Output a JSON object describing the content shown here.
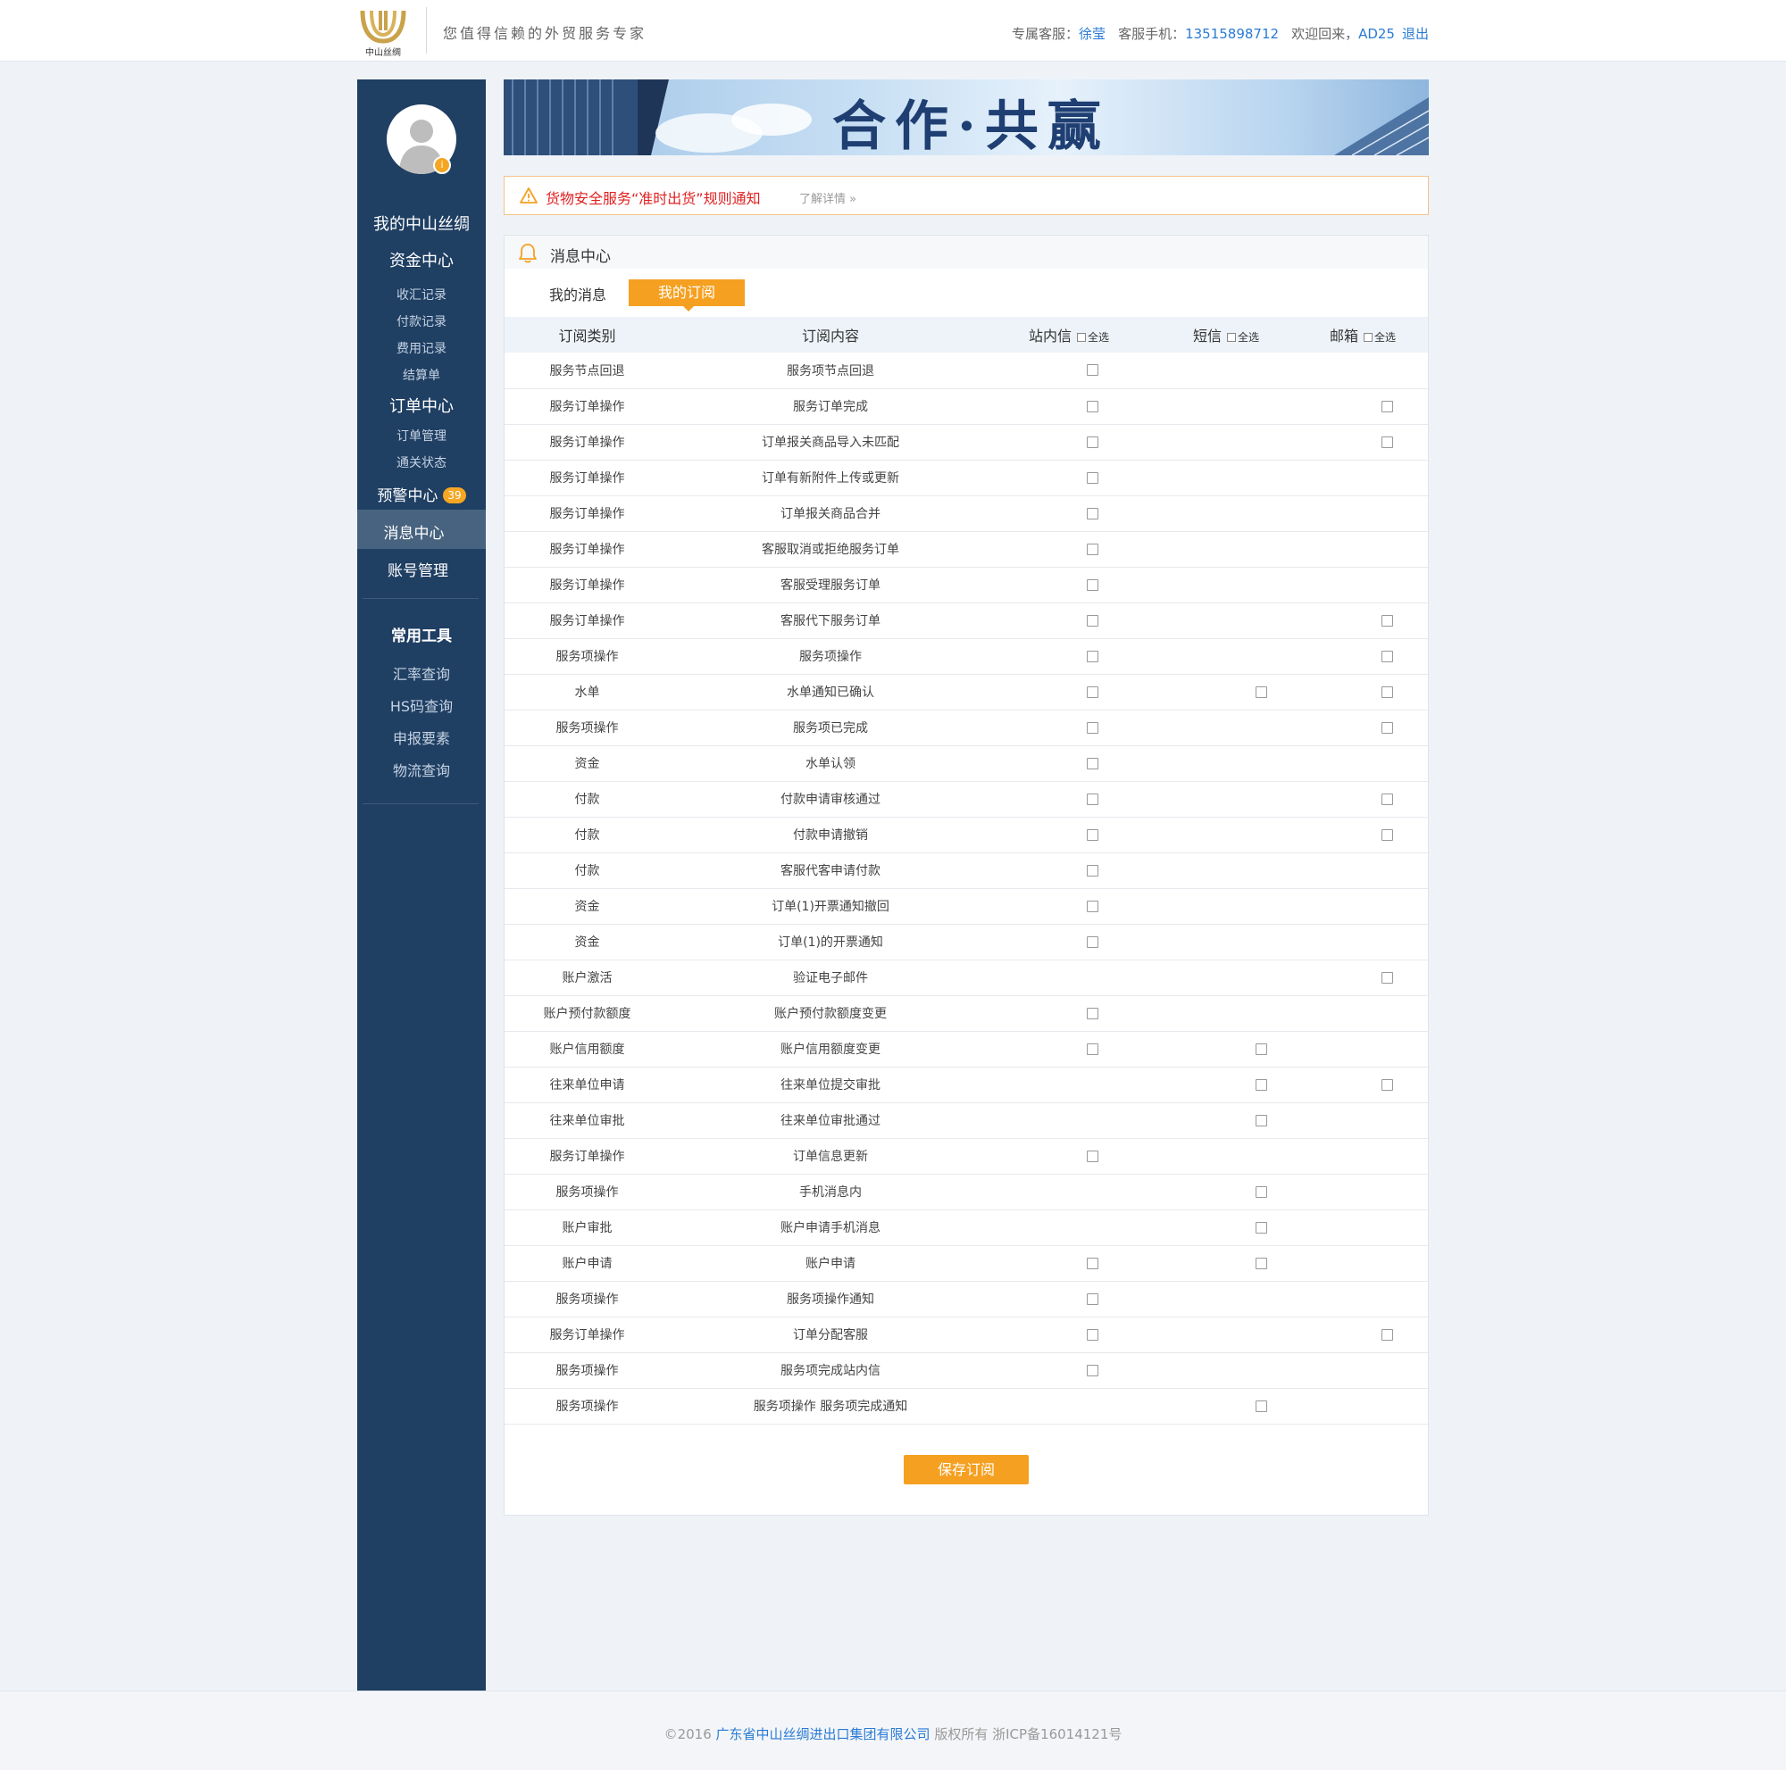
{
  "header": {
    "logo_text": "中山丝绸",
    "slogan": "您值得信赖的外贸服务专家",
    "service_label": "专属客服：",
    "service_name": "徐莹",
    "phone_label": "客服手机：",
    "phone": "13515898712",
    "welcome": "欢迎回来，",
    "username": "AD25",
    "logout": "退出"
  },
  "sidebar": {
    "avatar_badge": "i",
    "my_title": "我的中山丝绸",
    "fund_center": "资金中心",
    "fund_items": [
      "收汇记录",
      "付款记录",
      "费用记录",
      "结算单"
    ],
    "order_center": "订单中心",
    "order_items": [
      "订单管理",
      "通关状态"
    ],
    "warn_center": "预警中心",
    "warn_count": "39",
    "msg_center": "消息中心",
    "account": "账号管理",
    "tools_title": "常用工具",
    "tools": [
      "汇率查询",
      "HS码查询",
      "申报要素",
      "物流查询"
    ]
  },
  "banner": {
    "text": "合作·共赢"
  },
  "notice": {
    "text": "货物安全服务“准时出货”规则通知",
    "more": "了解详情 »"
  },
  "panel": {
    "title": "消息中心",
    "tabs": [
      "我的消息",
      "我的订阅"
    ],
    "columns": {
      "category": "订阅类别",
      "content": "订阅内容",
      "inbox": "站内信",
      "sms": "短信",
      "mail": "邮箱"
    },
    "select_all": "全选",
    "rows": [
      {
        "cat": "服务节点回退",
        "content": "服务项节点回退",
        "in": true,
        "sms": false,
        "mail": false
      },
      {
        "cat": "服务订单操作",
        "content": "服务订单完成",
        "in": true,
        "sms": false,
        "mail": true
      },
      {
        "cat": "服务订单操作",
        "content": "订单报关商品导入未匹配",
        "in": true,
        "sms": false,
        "mail": true
      },
      {
        "cat": "服务订单操作",
        "content": "订单有新附件上传或更新",
        "in": true,
        "sms": false,
        "mail": false
      },
      {
        "cat": "服务订单操作",
        "content": "订单报关商品合并",
        "in": true,
        "sms": false,
        "mail": false
      },
      {
        "cat": "服务订单操作",
        "content": "客服取消或拒绝服务订单",
        "in": true,
        "sms": false,
        "mail": false
      },
      {
        "cat": "服务订单操作",
        "content": "客服受理服务订单",
        "in": true,
        "sms": false,
        "mail": false
      },
      {
        "cat": "服务订单操作",
        "content": "客服代下服务订单",
        "in": true,
        "sms": false,
        "mail": true
      },
      {
        "cat": "服务项操作",
        "content": "服务项操作",
        "in": true,
        "sms": false,
        "mail": true
      },
      {
        "cat": "水单",
        "content": "水单通知已确认",
        "in": true,
        "sms": true,
        "mail": true
      },
      {
        "cat": "服务项操作",
        "content": "服务项已完成",
        "in": true,
        "sms": false,
        "mail": true
      },
      {
        "cat": "资金",
        "content": "水单认领",
        "in": true,
        "sms": false,
        "mail": false
      },
      {
        "cat": "付款",
        "content": "付款申请审核通过",
        "in": true,
        "sms": false,
        "mail": true
      },
      {
        "cat": "付款",
        "content": "付款申请撤销",
        "in": true,
        "sms": false,
        "mail": true
      },
      {
        "cat": "付款",
        "content": "客服代客申请付款",
        "in": true,
        "sms": false,
        "mail": false
      },
      {
        "cat": "资金",
        "content": "订单(1)开票通知撤回",
        "in": true,
        "sms": false,
        "mail": false
      },
      {
        "cat": "资金",
        "content": "订单(1)的开票通知",
        "in": true,
        "sms": false,
        "mail": false
      },
      {
        "cat": "账户激活",
        "content": "验证电子邮件",
        "in": false,
        "sms": false,
        "mail": true
      },
      {
        "cat": "账户预付款额度",
        "content": "账户预付款额度变更",
        "in": true,
        "sms": false,
        "mail": false
      },
      {
        "cat": "账户信用额度",
        "content": "账户信用额度变更",
        "in": true,
        "sms": true,
        "mail": false
      },
      {
        "cat": "往来单位申请",
        "content": "往来单位提交审批",
        "in": false,
        "sms": true,
        "mail": true
      },
      {
        "cat": "往来单位审批",
        "content": "往来单位审批通过",
        "in": false,
        "sms": true,
        "mail": false
      },
      {
        "cat": "服务订单操作",
        "content": "订单信息更新",
        "in": true,
        "sms": false,
        "mail": false
      },
      {
        "cat": "服务项操作",
        "content": "手机消息内",
        "in": false,
        "sms": true,
        "mail": false
      },
      {
        "cat": "账户审批",
        "content": "账户申请手机消息",
        "in": false,
        "sms": true,
        "mail": false
      },
      {
        "cat": "账户申请",
        "content": "账户申请",
        "in": true,
        "sms": true,
        "mail": false
      },
      {
        "cat": "服务项操作",
        "content": "服务项操作通知",
        "in": true,
        "sms": false,
        "mail": false
      },
      {
        "cat": "服务订单操作",
        "content": "订单分配客服",
        "in": true,
        "sms": false,
        "mail": true
      },
      {
        "cat": "服务项操作",
        "content": "服务项完成站内信",
        "in": true,
        "sms": false,
        "mail": false
      },
      {
        "cat": "服务项操作",
        "content": "服务项操作 服务项完成通知",
        "in": false,
        "sms": true,
        "mail": false
      }
    ],
    "save_label": "保存订阅"
  },
  "footer": {
    "prefix": "©2016 ",
    "company": "广东省中山丝绸进出口集团有限公司",
    "suffix": " 版权所有 浙ICP备16014121号"
  },
  "colors": {
    "sidebar_bg": "#1f3f63",
    "accent_orange": "#f5a021",
    "link_blue": "#2a7bd4",
    "notice_red": "#e02020"
  }
}
